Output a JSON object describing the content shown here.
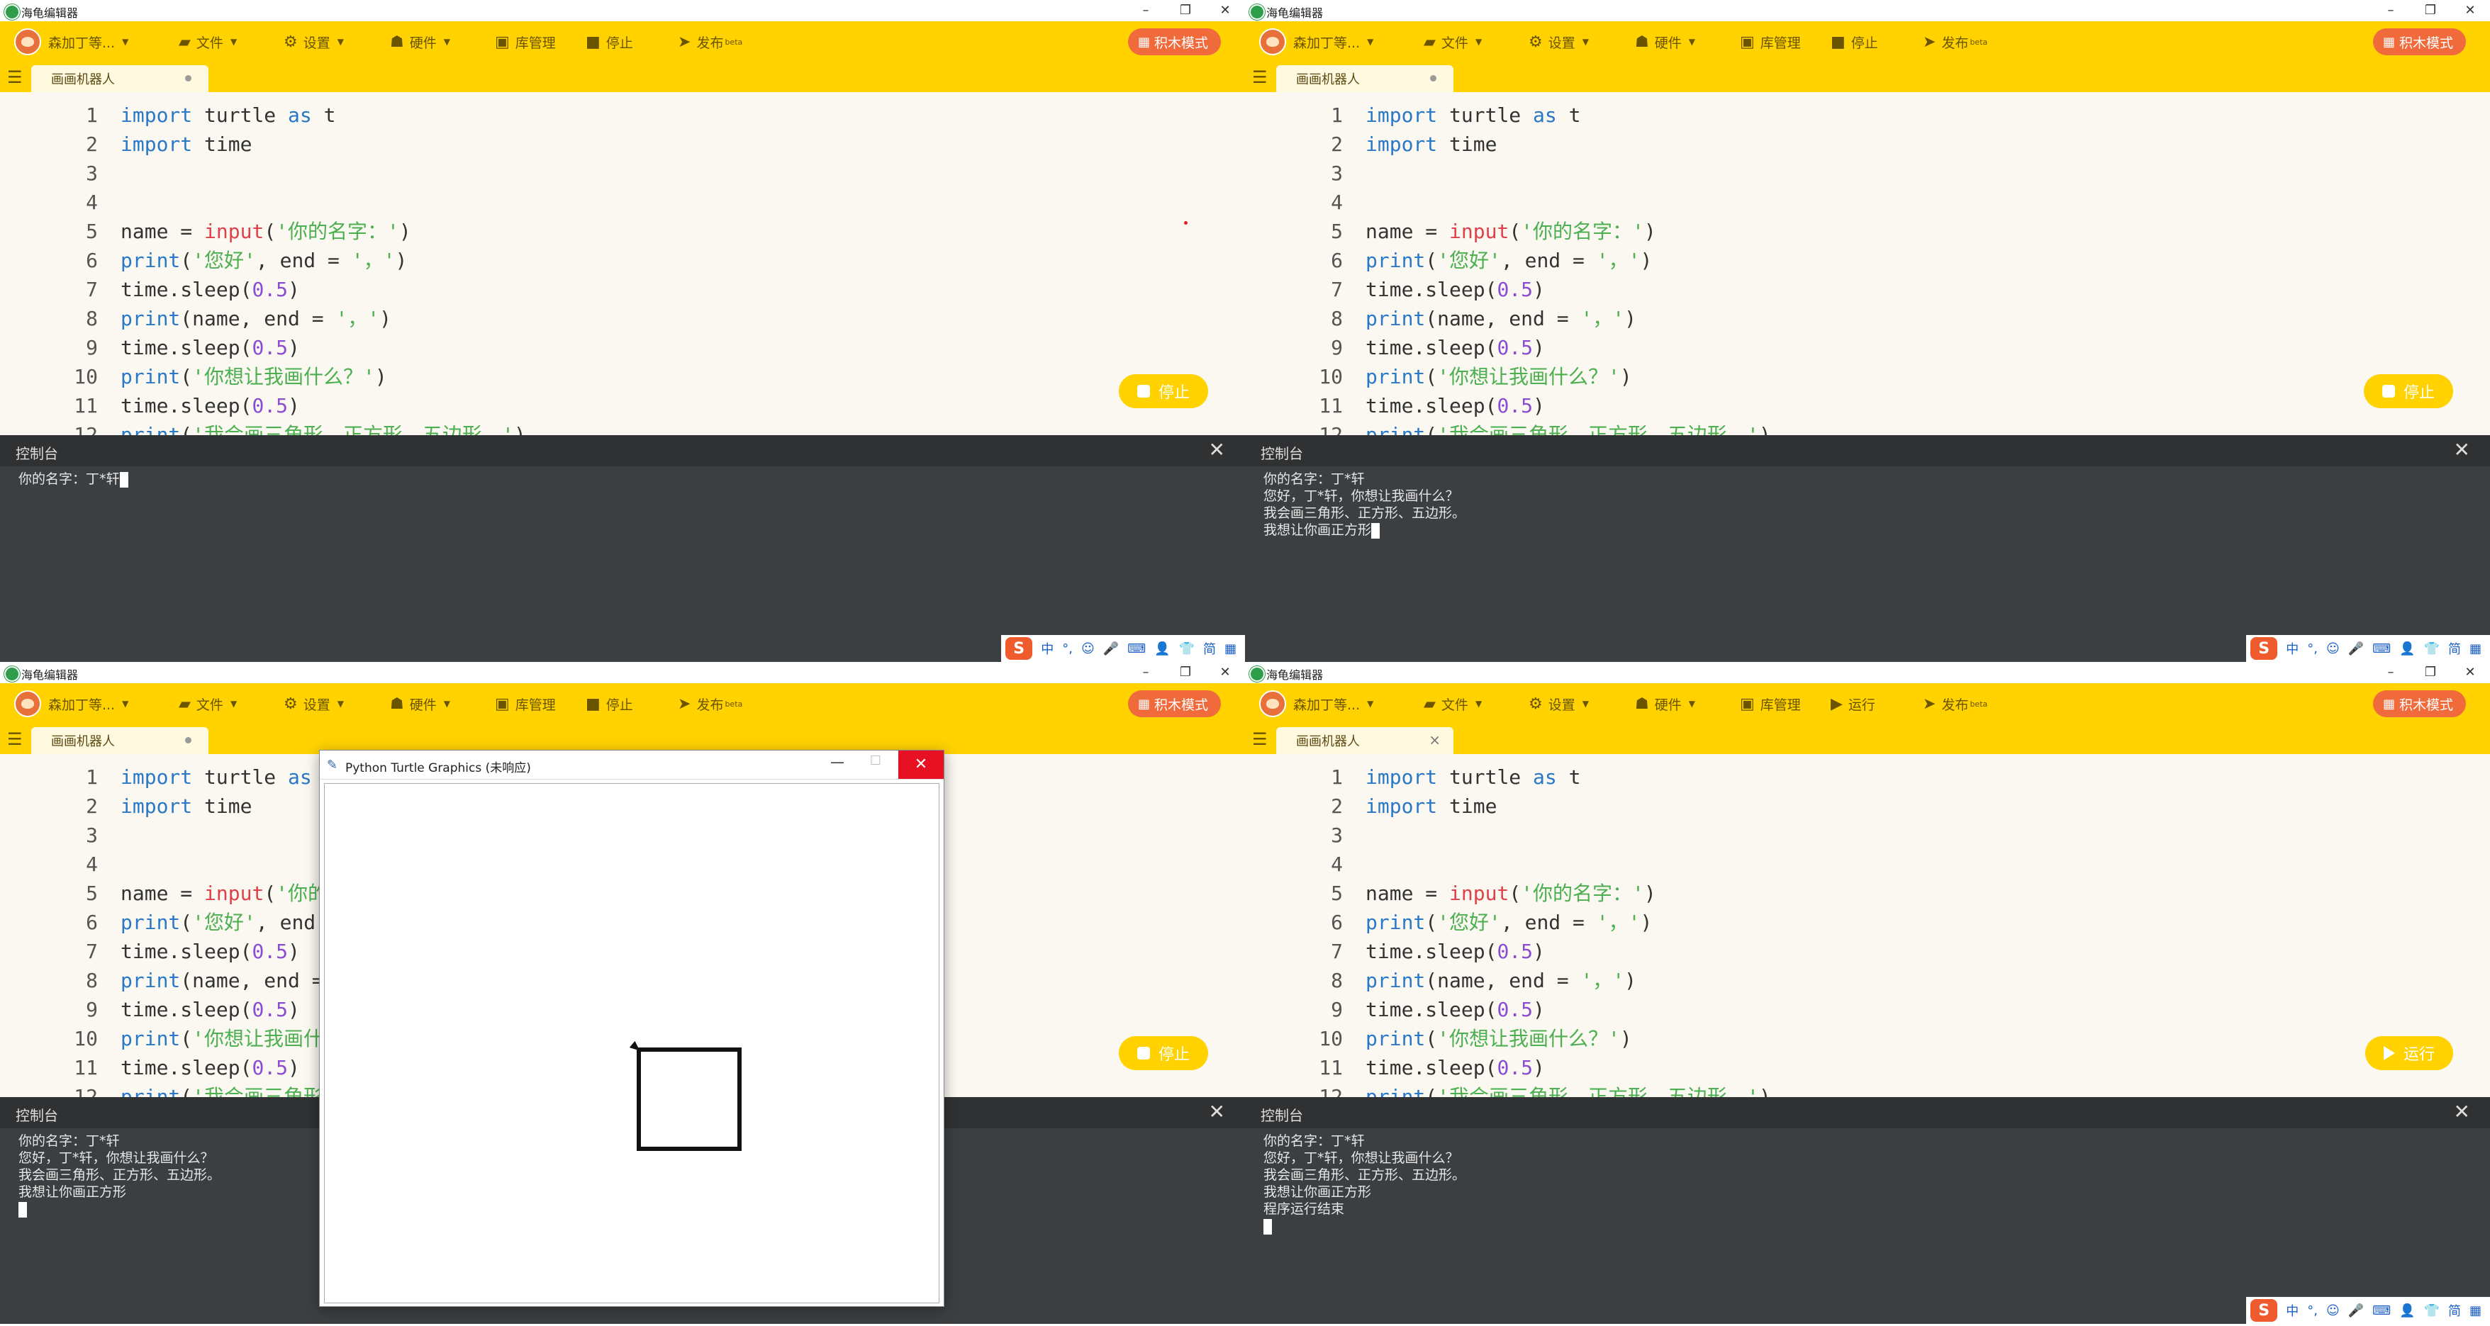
{
  "app": {
    "window_title": "海龟编辑器",
    "toolbar": {
      "user": "森加丁等...",
      "file": "文件",
      "settings": "设置",
      "hardware": "硬件",
      "library": "库管理",
      "stop": "停止",
      "run": "运行",
      "publish": "发布",
      "publish_badge": "beta",
      "block_mode": "积木模式"
    },
    "tab_name": "画画机器人",
    "console_title": "控制台"
  },
  "code_lines": [
    {
      "n": "1",
      "text": "import turtle as t"
    },
    {
      "n": "2",
      "text": "import time"
    },
    {
      "n": "3",
      "text": ""
    },
    {
      "n": "4",
      "text": ""
    },
    {
      "n": "5",
      "text": "name = input('你的名字：')"
    },
    {
      "n": "6",
      "text": "print('您好', end = '，')"
    },
    {
      "n": "7",
      "text": "time.sleep(0.5)"
    },
    {
      "n": "8",
      "text": "print(name, end = '，')"
    },
    {
      "n": "9",
      "text": "time.sleep(0.5)"
    },
    {
      "n": "10",
      "text": "print('你想让我画什么？')"
    },
    {
      "n": "11",
      "text": "time.sleep(0.5)"
    },
    {
      "n": "12",
      "text": "print('我会画三角形、正方形、五边形。')"
    }
  ],
  "panes": [
    {
      "run_button": "停止",
      "toolbar_action": "停止",
      "console": [
        "你的名字：丁*轩"
      ]
    },
    {
      "run_button": "停止",
      "toolbar_action": "停止",
      "console": [
        "你的名字：丁*轩",
        "您好，丁*轩，你想让我画什么？",
        "我会画三角形、正方形、五边形。",
        "我想让你画正方形"
      ]
    },
    {
      "run_button": "停止",
      "toolbar_action": "停止",
      "console": [
        "你的名字：丁*轩",
        "您好，丁*轩，你想让我画什么？",
        "我会画三角形、正方形、五边形。",
        "我想让你画正方形"
      ]
    },
    {
      "run_button": "运行",
      "toolbar_action": "运行",
      "console": [
        "你的名字：丁*轩",
        "您好，丁*轩，你想让我画什么？",
        "我会画三角形、正方形、五边形。",
        "我想让你画正方形",
        "程序运行结束"
      ]
    }
  ],
  "turtle_window": {
    "title": "Python Turtle Graphics (未响应)"
  },
  "ime": {
    "logo": "S",
    "items": [
      "中",
      "°,",
      "☺",
      "🎤",
      "⌨",
      "👤",
      "👕",
      "简",
      "▦"
    ]
  },
  "colors": {
    "toolbar": "#ffd200",
    "accent": "#f06a3b",
    "console_bg": "#3c3f41",
    "editor_bg": "#faf8f0"
  }
}
